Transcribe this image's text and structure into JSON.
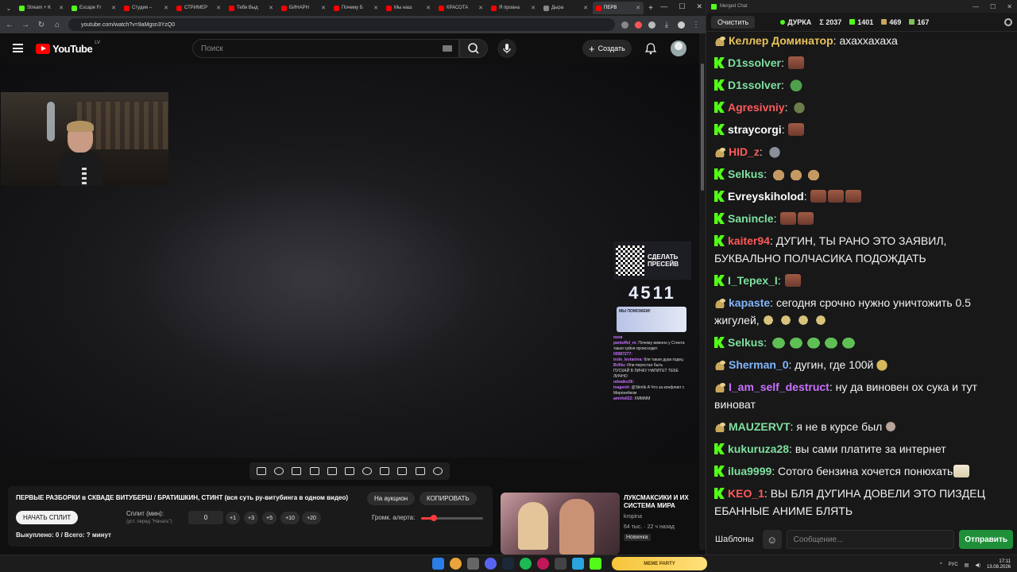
{
  "browser": {
    "tabs": [
      {
        "label": "Stream + K",
        "color": "#53fc18"
      },
      {
        "label": "Escape Fr",
        "color": "#53fc18"
      },
      {
        "label": "Студия –",
        "color": "#ff0000"
      },
      {
        "label": "СТРИМЕР",
        "color": "#ff0000"
      },
      {
        "label": "Тебя Выд",
        "color": "#ff0000"
      },
      {
        "label": "БИНАРН",
        "color": "#ff0000"
      },
      {
        "label": "Почему Б",
        "color": "#ff0000"
      },
      {
        "label": "Мы наш",
        "color": "#ff0000"
      },
      {
        "label": "КРАСОТА",
        "color": "#ff0000"
      },
      {
        "label": "Я проана",
        "color": "#ff0000"
      },
      {
        "label": "Дыра",
        "color": "#888888"
      },
      {
        "label": "ПЕРВ",
        "color": "#ff0000"
      }
    ],
    "url": "youtube.com/watch?v=9aMgsn3YzQ0"
  },
  "youtube": {
    "logo": "YouTube",
    "country": "LV",
    "search_placeholder": "Поиск",
    "create_label": "Создать",
    "icons": {
      "menu": "menu-icon",
      "search": "search-icon",
      "mic": "mic-icon",
      "bell": "bell-icon"
    }
  },
  "overlay": {
    "qr_text_1": "СДЕЛАТЬ",
    "qr_text_2": "ПРЕСЕЙВ",
    "big_number": "4511",
    "help_card": "МЫ ПОМОЖЕМ!",
    "mini_chat": [
      {
        "nick": "язов",
        "text": ""
      },
      {
        "nick": "pantoffel_m:",
        "text": "Почему именно у Стинта такая хуйня происходит"
      },
      {
        "nick": "00987277:",
        "text": ""
      },
      {
        "nick": "trolo_levtaniva:",
        "text": "бля такая дура пздец"
      },
      {
        "nick": "Brilliu:",
        "text": "Или перестал быть"
      },
      {
        "nick": "",
        "text": "ПУСКАЙ В ЛИЧКУ НАПИТЕТ ТЕБЕ ЛИЧНО"
      },
      {
        "nick": "odeaiko36:",
        "text": ""
      },
      {
        "nick": "inagentt:",
        "text": "@Stintik А Что за конфликт с Миронейком"
      },
      {
        "nick": "amirlo022:",
        "text": "ХММММ"
      }
    ]
  },
  "panel": {
    "title": "ПЕРВЫЕ РАЗБОРКИ в СКВАДЕ ВИТУБЕРШ / БРАТИШКИН, СТИНТ (вся суть ру-витубинга в одном видео)",
    "auction": "На аукцион",
    "copy": "КОПИРОВАТЬ",
    "start_split": "НАЧАТЬ СПЛИТ",
    "split_label": "Сплит (мин):",
    "split_sub": "(уст. перед \"Начать\")",
    "split_value": "0",
    "inc": [
      "+1",
      "+3",
      "+5",
      "+10",
      "+20"
    ],
    "alert_label": "Громк. алерта:",
    "alert_level": 0.2,
    "footer": "Выкуплено: 0 / Всего: ? минут"
  },
  "recommendation": {
    "title": "ЛУКСМАКСИКИ И ИХ СИСТЕМА МИРА",
    "channel": "kropina",
    "meta": "64 тыс. · 22 ч назад",
    "badge": "Новинка"
  },
  "chat": {
    "window_title": "Merged Chat",
    "clear": "Очистить",
    "channel": "ДУРКА",
    "sum": "Σ 2037",
    "kick_count": "1401",
    "twitch_count": "469",
    "other_count": "167",
    "messages": [
      {
        "platform": "twitch",
        "nick": "Келлер Доминатор",
        "color": "#e8c35a",
        "text": "ахаххахаха",
        "emotes": []
      },
      {
        "platform": "kick",
        "nick": "D1ssolver",
        "color": "#7fe0a0",
        "text": "",
        "emotes": [
          "em-face"
        ]
      },
      {
        "platform": "kick",
        "nick": "D1ssolver",
        "color": "#7fe0a0",
        "text": "",
        "emotes": [
          "em-pepe"
        ]
      },
      {
        "platform": "kick",
        "nick": "Agresivniy",
        "color": "#ff5a5a",
        "text": "",
        "emotes": [
          "em-frog"
        ]
      },
      {
        "platform": "kick",
        "nick": "straycorgi",
        "color": "#ffffff",
        "text": "",
        "emotes": [
          "em-face"
        ]
      },
      {
        "platform": "twitch",
        "nick": "HID_z",
        "color": "#ff5a5a",
        "text": "",
        "emotes": [
          "em-stone"
        ]
      },
      {
        "platform": "kick",
        "nick": "Selkus",
        "color": "#7fe0a0",
        "text": "",
        "emotes": [
          "em-bread",
          "em-bread",
          "em-bread"
        ]
      },
      {
        "platform": "kick",
        "nick": "Evreyskiholod",
        "color": "#ffffff",
        "text": "",
        "emotes": [
          "em-face",
          "em-face",
          "em-face"
        ]
      },
      {
        "platform": "kick",
        "nick": "Sanincle",
        "color": "#7fe0a0",
        "text": "",
        "emotes": [
          "em-face",
          "em-face"
        ]
      },
      {
        "platform": "kick",
        "nick": "kaiter94",
        "color": "#ff5a5a",
        "text": "ДУГИН, ТЫ РАНО ЭТО ЗАЯВИЛ, БУКВАЛЬНО ПОЛЧАСИКА ПОДОЖДАТЬ",
        "emotes": []
      },
      {
        "platform": "kick",
        "nick": "I_Tepex_I",
        "color": "#7fe0a0",
        "text": "",
        "emotes": [
          "em-face"
        ]
      },
      {
        "platform": "twitch",
        "nick": "kapaste",
        "color": "#7fb6ff",
        "text": "сегодня срочно нужно уничтожить 0.5 жигулей,",
        "emotes": [
          "em-head",
          "em-head",
          "em-head",
          "em-head"
        ]
      },
      {
        "platform": "kick",
        "nick": "Selkus",
        "color": "#7fe0a0",
        "text": "",
        "emotes": [
          "em-pepe-g",
          "em-pepe-g",
          "em-pepe-g",
          "em-pepe-g",
          "em-pepe-g"
        ]
      },
      {
        "platform": "twitch",
        "nick": "Sherman_0",
        "color": "#7fb6ff",
        "text": "дугин, где 100й",
        "emotes": [
          "em-angry"
        ]
      },
      {
        "platform": "twitch",
        "nick": "I_am_self_destruct",
        "color": "#c970ff",
        "text": "ну да виновен ох сука и тут виноват",
        "emotes": []
      },
      {
        "platform": "twitch",
        "nick": "MAUZERVT",
        "color": "#7fe0a0",
        "text": "я не в курсе был",
        "emotes": [
          "em-dark"
        ]
      },
      {
        "platform": "kick",
        "nick": "kukuruza28",
        "color": "#7fe0a0",
        "text": "вы сами платите за интернет",
        "emotes": []
      },
      {
        "platform": "kick",
        "nick": "ilua9999",
        "color": "#7fe0a0",
        "text": "Сотого бензина хочется понюхать",
        "emotes": [
          "em-cat"
        ]
      },
      {
        "platform": "kick",
        "nick": "KEO_1",
        "color": "#ff5a5a",
        "text": "ВЫ БЛЯ ДУГИНА ДОВЕЛИ ЭТО ПИЗДЕЦ ЕБАННЫЕ АНИМЕ БЛЯТЬ",
        "emotes": []
      }
    ],
    "templates": "Шаблоны",
    "input_placeholder": "Сообщение...",
    "send": "Отправить"
  },
  "taskbar": {
    "meme_widget": "MEME PARTY",
    "lang": "РУС",
    "time": "17:11",
    "date": "13.08.2026"
  }
}
